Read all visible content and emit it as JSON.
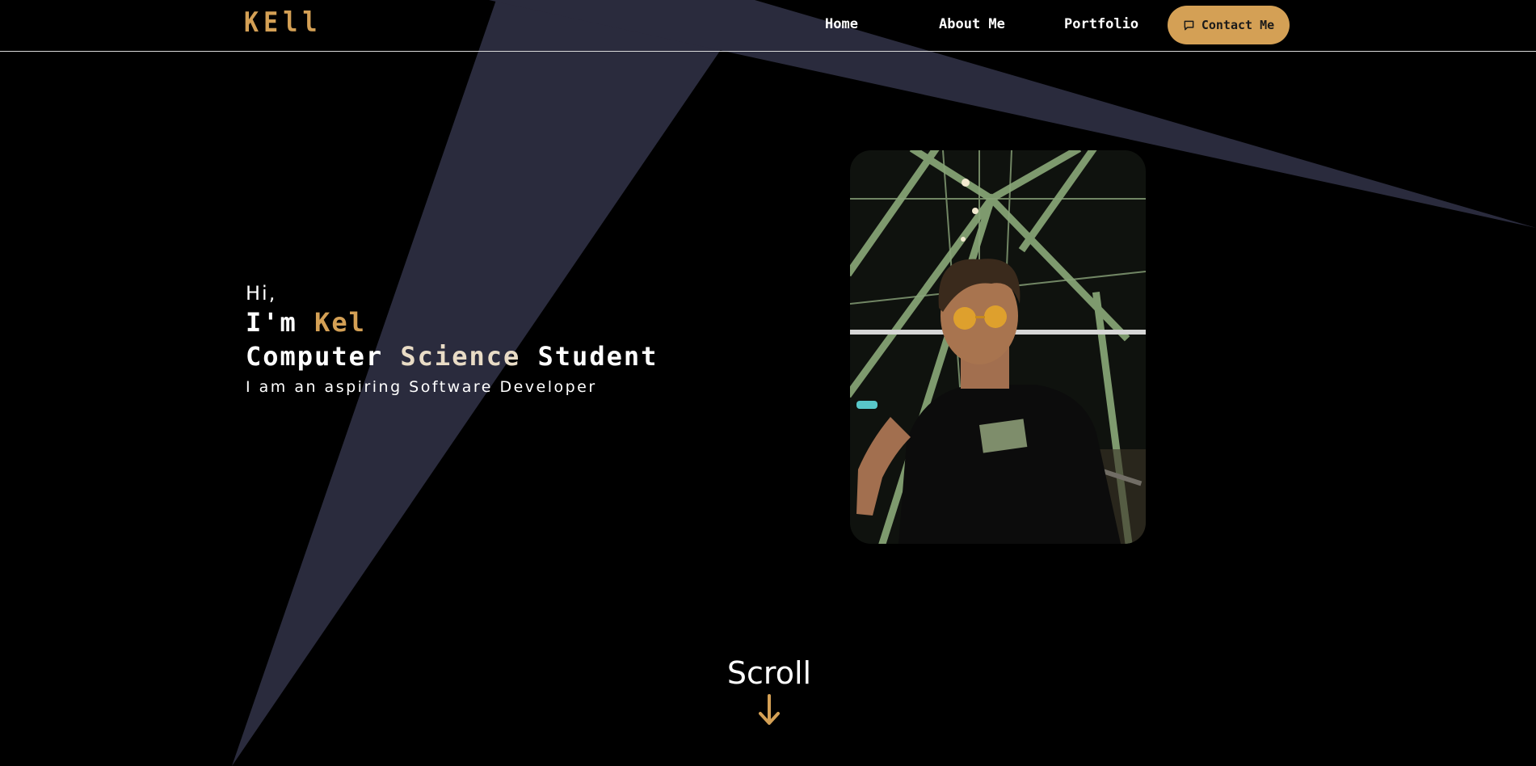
{
  "colors": {
    "background": "#000000",
    "accent": "#d4a055",
    "shape": "#2a2b3d",
    "muted_text": "#e9dcc6",
    "button_text": "#1a1a1a"
  },
  "nav": {
    "logo": "KEll",
    "links": [
      "Home",
      "About Me",
      "Portfolio"
    ],
    "contact_label": "Contact Me",
    "contact_icon": "chat-bubble-icon"
  },
  "hero": {
    "greeting": "Hi,",
    "intro_prefix": "I'm ",
    "name": "Kel",
    "role_word1": "Computer ",
    "role_word2": "Science",
    "role_word3": " Student",
    "tagline": "I am an aspiring Software Developer"
  },
  "scroll": {
    "label": "Scroll",
    "icon": "arrow-down-icon"
  }
}
